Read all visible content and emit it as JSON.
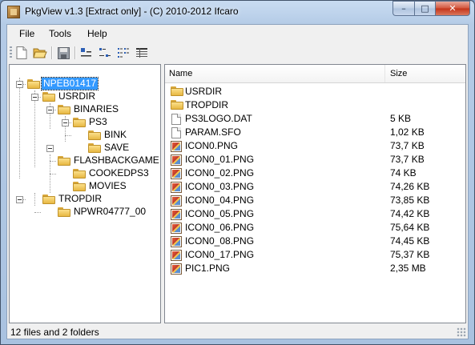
{
  "window": {
    "title": "PkgView v1.3 [Extract only] - (C) 2010-2012 Ifcaro"
  },
  "caption_buttons": {
    "minimize": "–",
    "maximize": "□",
    "close": "✕"
  },
  "menu": [
    "File",
    "Tools",
    "Help"
  ],
  "toolbar": [
    {
      "icon": "new-file-icon"
    },
    {
      "icon": "open-folder-icon"
    },
    {
      "icon": "save-icon"
    },
    {
      "icon": "large-icons-view-icon"
    },
    {
      "icon": "small-icons-view-icon"
    },
    {
      "icon": "list-view-icon"
    },
    {
      "icon": "details-view-icon"
    }
  ],
  "tree": [
    {
      "label": "NPEB01417",
      "selected": true
    },
    {
      "label": "USRDIR"
    },
    {
      "label": "BINARIES"
    },
    {
      "label": "PS3"
    },
    {
      "label": "BINK"
    },
    {
      "label": "SAVE"
    },
    {
      "label": "FLASHBACKGAME"
    },
    {
      "label": "COOKEDPS3"
    },
    {
      "label": "MOVIES"
    },
    {
      "label": "TROPDIR"
    },
    {
      "label": "NPWR04777_00"
    }
  ],
  "list": {
    "columns": {
      "name": "Name",
      "size": "Size"
    },
    "rows": [
      {
        "name": "USRDIR",
        "size": "",
        "type": "folder"
      },
      {
        "name": "TROPDIR",
        "size": "",
        "type": "folder"
      },
      {
        "name": "PS3LOGO.DAT",
        "size": "5 KB",
        "type": "file"
      },
      {
        "name": "PARAM.SFO",
        "size": "1,02 KB",
        "type": "file"
      },
      {
        "name": "ICON0.PNG",
        "size": "73,7 KB",
        "type": "image"
      },
      {
        "name": "ICON0_01.PNG",
        "size": "73,7 KB",
        "type": "image"
      },
      {
        "name": "ICON0_02.PNG",
        "size": "74 KB",
        "type": "image"
      },
      {
        "name": "ICON0_03.PNG",
        "size": "74,26 KB",
        "type": "image"
      },
      {
        "name": "ICON0_04.PNG",
        "size": "73,85 KB",
        "type": "image"
      },
      {
        "name": "ICON0_05.PNG",
        "size": "74,42 KB",
        "type": "image"
      },
      {
        "name": "ICON0_06.PNG",
        "size": "75,64 KB",
        "type": "image"
      },
      {
        "name": "ICON0_08.PNG",
        "size": "74,45 KB",
        "type": "image"
      },
      {
        "name": "ICON0_17.PNG",
        "size": "75,37 KB",
        "type": "image"
      },
      {
        "name": "PIC1.PNG",
        "size": "2,35 MB",
        "type": "image"
      }
    ]
  },
  "status": {
    "text": "12 files and 2 folders"
  }
}
